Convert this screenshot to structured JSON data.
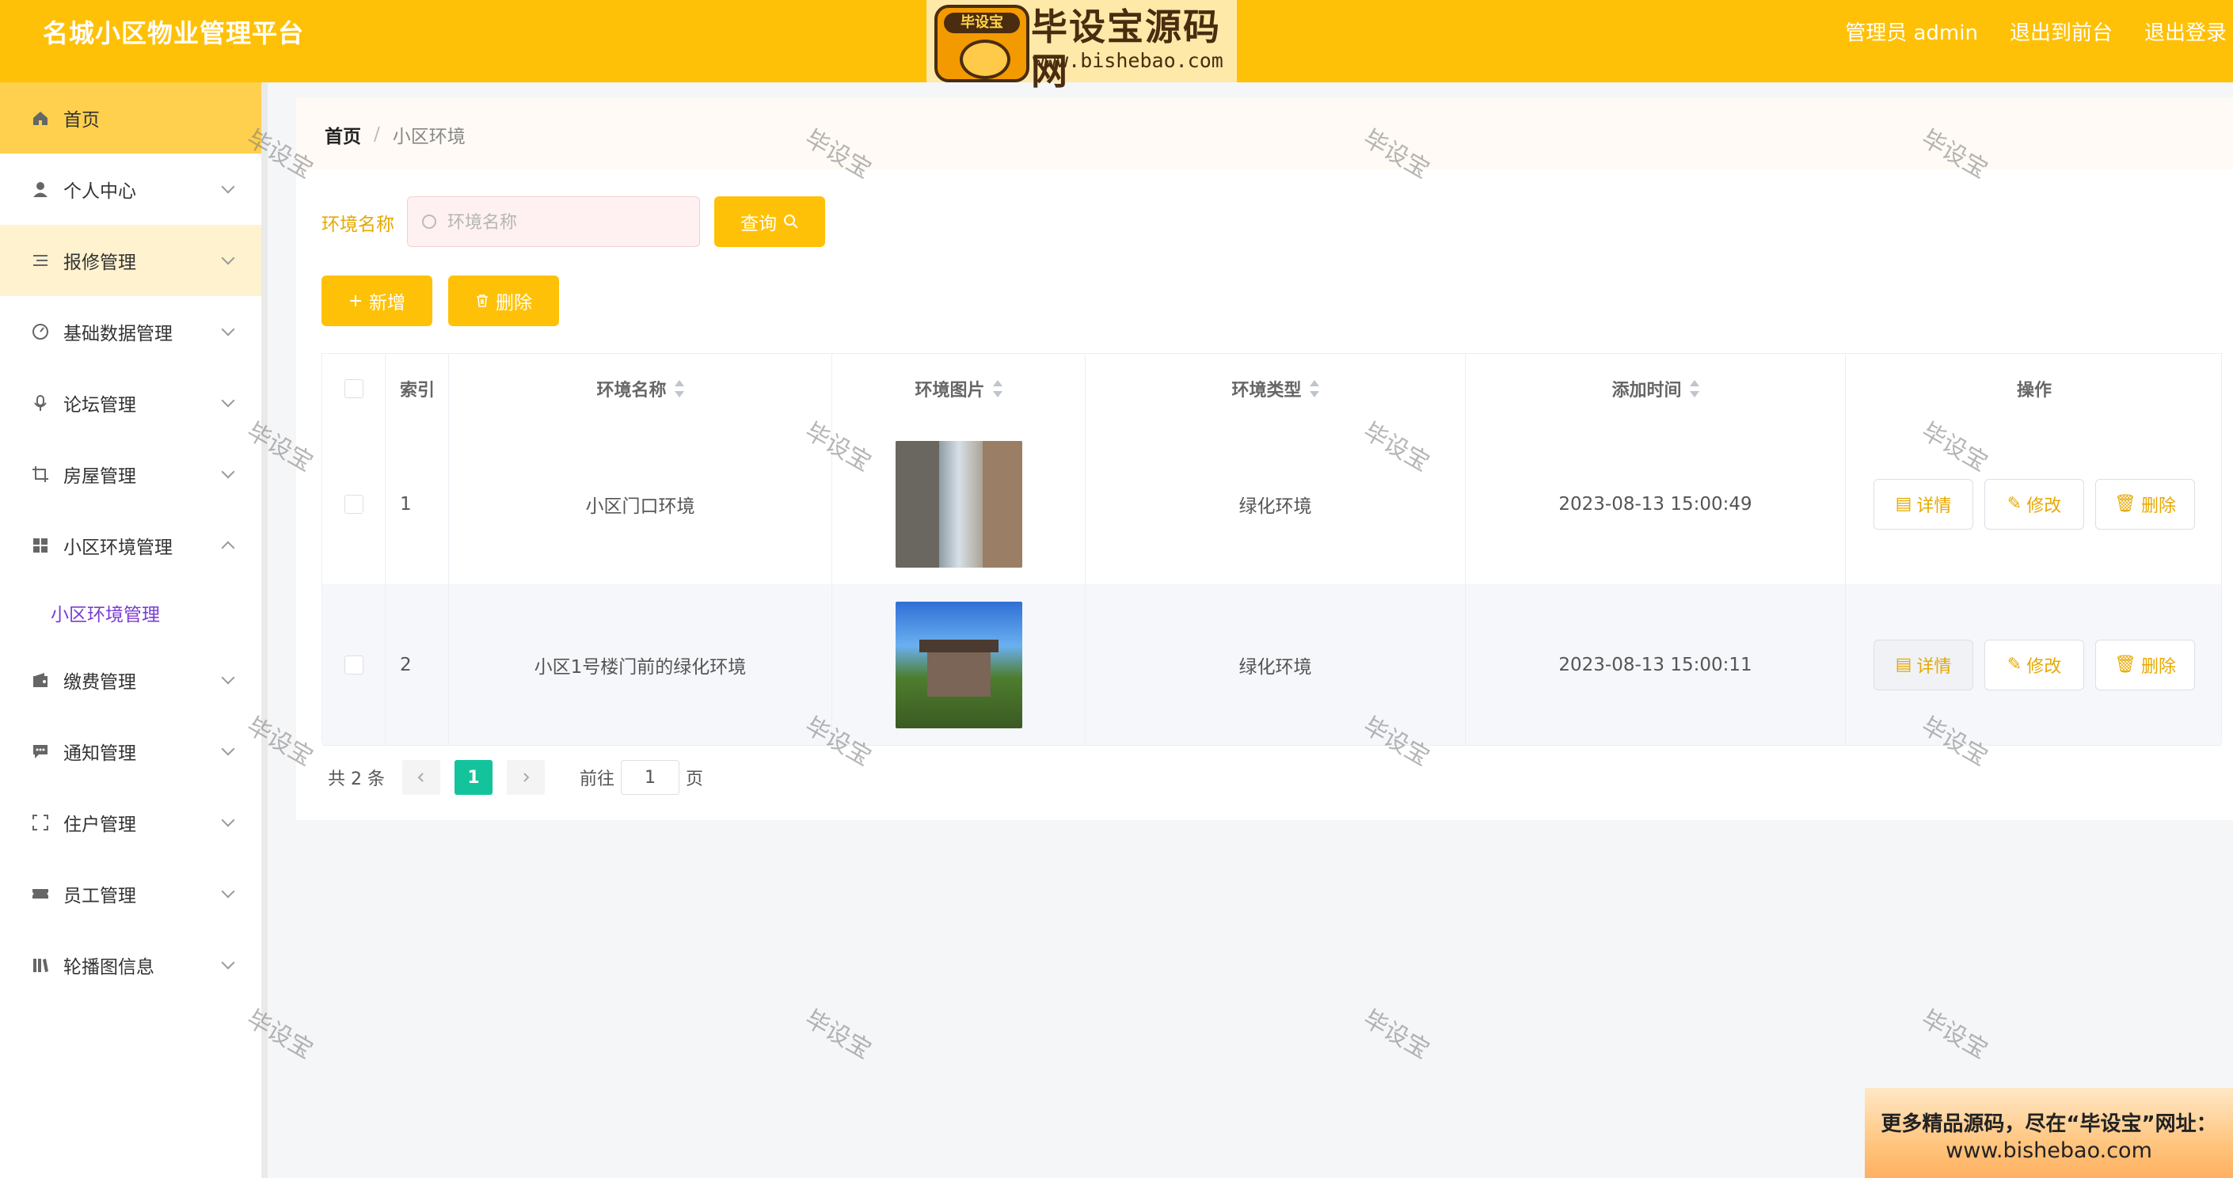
{
  "header": {
    "title": "名城小区物业管理平台",
    "logo": {
      "badge": "毕设宝",
      "name": "毕设宝源码网",
      "url": "www.bishebao.com"
    },
    "user_label": "管理员 admin",
    "front_link": "退出到前台",
    "logout_link": "退出登录",
    "accent_color": "#ffc107"
  },
  "sidebar": {
    "items": [
      {
        "label": "首页",
        "icon": "home-icon",
        "active": true
      },
      {
        "label": "个人中心",
        "icon": "user-icon"
      },
      {
        "label": "报修管理",
        "icon": "list-icon"
      },
      {
        "label": "基础数据管理",
        "icon": "gauge-icon"
      },
      {
        "label": "论坛管理",
        "icon": "microphone-icon"
      },
      {
        "label": "房屋管理",
        "icon": "crop-icon"
      },
      {
        "label": "小区环境管理",
        "icon": "grid-icon",
        "expanded": true
      },
      {
        "label": "缴费管理",
        "icon": "wallet-icon"
      },
      {
        "label": "通知管理",
        "icon": "chat-icon"
      },
      {
        "label": "住户管理",
        "icon": "fullscreen-icon"
      },
      {
        "label": "员工管理",
        "icon": "ticket-icon"
      },
      {
        "label": "轮播图信息",
        "icon": "bookshelf-icon"
      }
    ],
    "submenu": {
      "label": "小区环境管理"
    }
  },
  "breadcrumb": {
    "home": "首页",
    "separator": "/",
    "current": "小区环境"
  },
  "search": {
    "label": "环境名称",
    "placeholder": "环境名称",
    "value": "",
    "query_button": "查询"
  },
  "actions": {
    "add": "新增",
    "delete": "删除"
  },
  "table": {
    "headers": [
      "索引",
      "环境名称",
      "环境图片",
      "环境类型",
      "添加时间",
      "操作"
    ],
    "rows": [
      {
        "index": "1",
        "name": "小区门口环境",
        "type": "绿化环境",
        "time": "2023-08-13 15:00:49"
      },
      {
        "index": "2",
        "name": "小区1号楼门前的绿化环境",
        "type": "绿化环境",
        "time": "2023-08-13 15:00:11"
      }
    ],
    "row_actions": {
      "detail": "详情",
      "edit": "修改",
      "delete": "删除"
    }
  },
  "pagination": {
    "total": "共 2 条",
    "current": "1",
    "goto_prefix": "前往",
    "goto_value": "1",
    "goto_suffix": "页"
  },
  "watermark": "毕设宝",
  "promo": {
    "line1": "更多精品源码，尽在“毕设宝”网址：",
    "line2": "www.bishebao.com"
  }
}
